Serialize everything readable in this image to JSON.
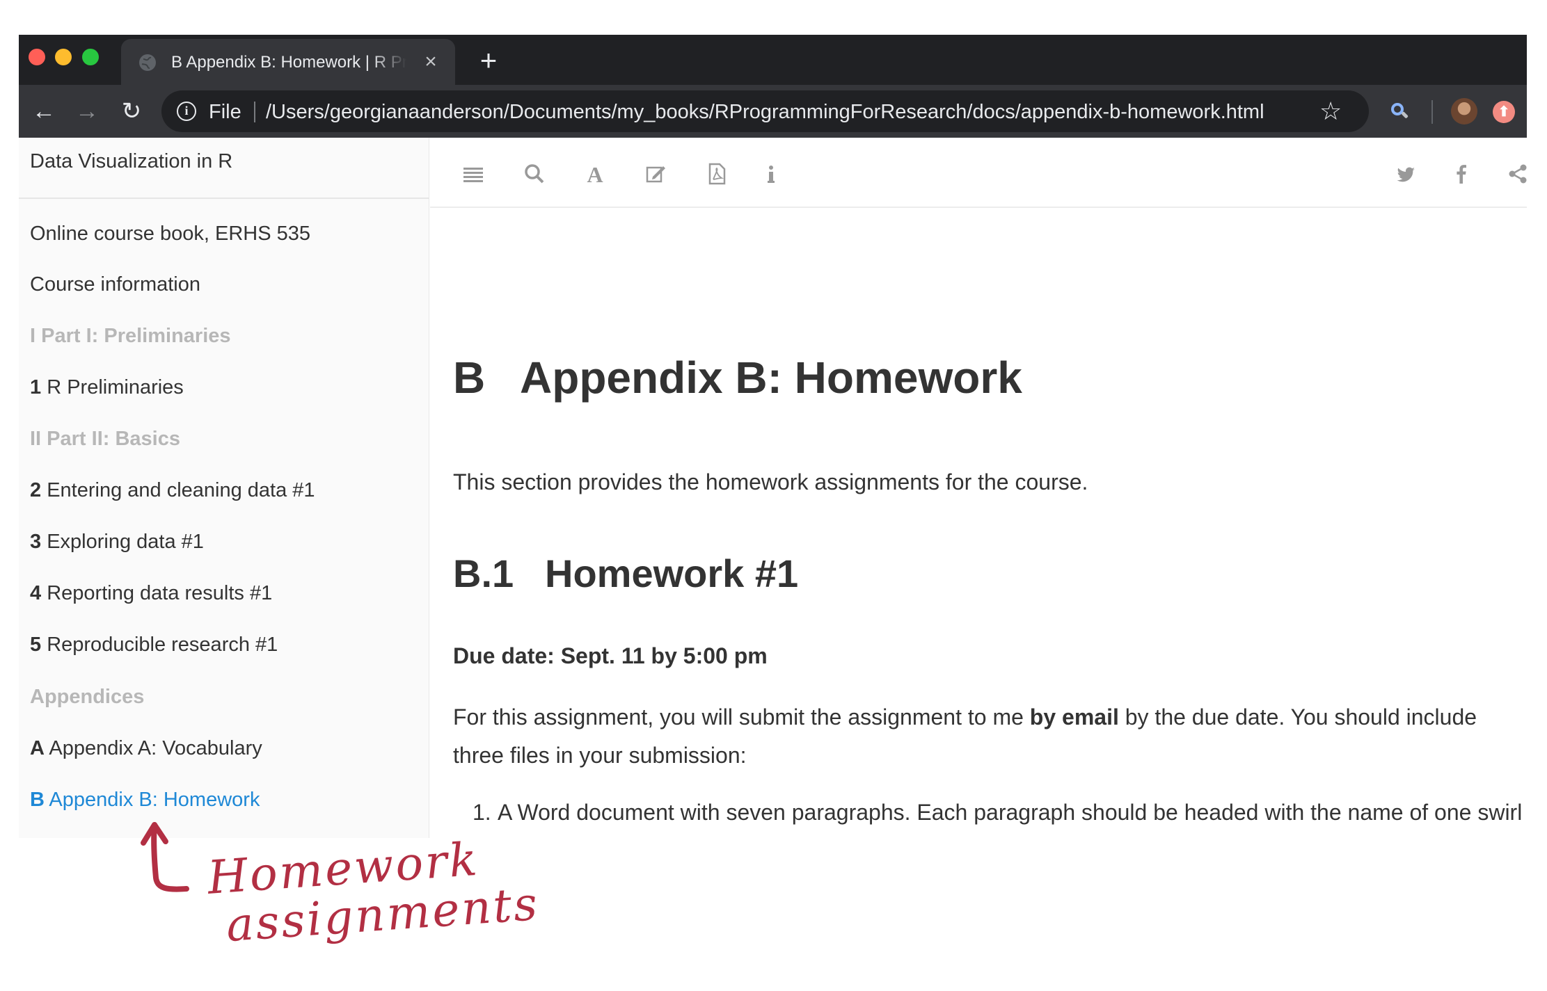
{
  "browser": {
    "tab_title": "B Appendix B: Homework | R Pr",
    "tab_close_glyph": "×",
    "new_tab_glyph": "+",
    "scheme": "File",
    "url": "/Users/georgianaanderson/Documents/my_books/RProgrammingForResearch/docs/appendix-b-homework.html",
    "icons": {
      "back": "←",
      "forward": "→",
      "reload": "↻",
      "star": "☆",
      "info": "i",
      "update": "⬆"
    }
  },
  "sidebar": {
    "title": "Data Visualization in R",
    "items": [
      {
        "label": "Online course book, ERHS 535",
        "kind": "item"
      },
      {
        "label": "Course information",
        "kind": "item"
      },
      {
        "label": "I Part I: Preliminaries",
        "kind": "part"
      },
      {
        "num": "1",
        "label": "R Preliminaries",
        "kind": "chapter"
      },
      {
        "label": "II Part II: Basics",
        "kind": "part"
      },
      {
        "num": "2",
        "label": "Entering and cleaning data #1",
        "kind": "chapter"
      },
      {
        "num": "3",
        "label": "Exploring data #1",
        "kind": "chapter"
      },
      {
        "num": "4",
        "label": "Reporting data results #1",
        "kind": "chapter"
      },
      {
        "num": "5",
        "label": "Reproducible research #1",
        "kind": "chapter"
      },
      {
        "label": "Appendices",
        "kind": "part"
      },
      {
        "num": "A",
        "label": "Appendix A: Vocabulary",
        "kind": "chapter"
      },
      {
        "num": "B",
        "label": "Appendix B: Homework",
        "kind": "active"
      }
    ]
  },
  "header_icons": [
    "toc-toggle-icon",
    "search-icon",
    "font-settings-icon",
    "edit-icon",
    "pdf-download-icon",
    "info-icon",
    "twitter-icon",
    "facebook-icon",
    "share-icon"
  ],
  "content": {
    "chapter_num": "B",
    "chapter_title": "Appendix B: Homework",
    "intro": "This section provides the homework assignments for the course.",
    "section_num": "B.1",
    "section_title": "Homework #1",
    "due": "Due date: Sept. 11 by 5:00 pm",
    "para_before": "For this assignment, you will submit the assignment to me ",
    "para_bold": "by email",
    "para_after": " by the due date. You should include three files in your submission:",
    "list_item_1_num": "1.",
    "list_item_1": "A Word document with seven paragraphs. Each paragraph should be headed with the name of one swirl lesson and the body of the paragraph should describe that lesson and what you learned from"
  },
  "annotation": {
    "line1": "Homework",
    "line2": "assignments",
    "color": "#b22f43"
  }
}
